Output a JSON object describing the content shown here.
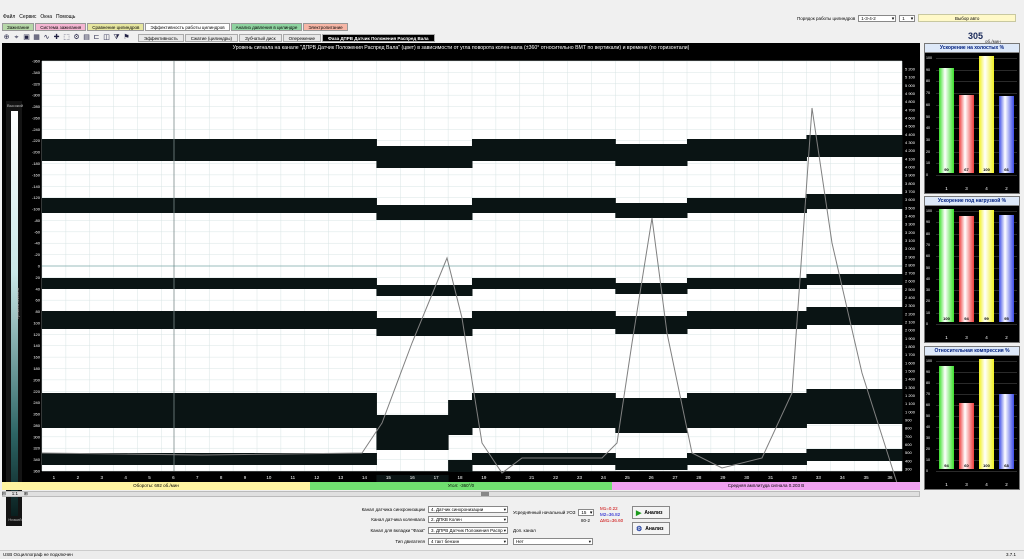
{
  "menu": [
    "Файл",
    "Сервис",
    "Окна",
    "Помощь"
  ],
  "top_tabs": [
    {
      "label": "Зажигание",
      "color": "#b6d7a8"
    },
    {
      "label": "Система зажигания",
      "color": "#f4b6d2"
    },
    {
      "label": "Сравнение цилиндров",
      "color": "#e6e6a0"
    },
    {
      "label": "Эффективность работы цилиндров",
      "color": "#ffffff"
    },
    {
      "label": "Анализ давления в цилиндре",
      "color": "#8fd3a0"
    },
    {
      "label": "Электропитание",
      "color": "#f6b6a6"
    }
  ],
  "top_right": {
    "order_label": "Порядок работы цилиндров",
    "order_value": "1-3-4-2",
    "cyl_value": "1",
    "car_select": "Выбор авто"
  },
  "toolbar_icons": [
    "zoom-icon",
    "cursor-icon",
    "photo-icon",
    "grid-icon",
    "channel-icon",
    "marker-icon",
    "zoom-area-icon",
    "settings-icon",
    "chart-icon",
    "ruler-icon",
    "cylinder-icon",
    "filter-icon",
    "flag-icon"
  ],
  "sub_tabs": [
    "Эффективность",
    "Сжатие (цилиндры)",
    "Зубчатый диск",
    "Опережение",
    "Фаза ДПРВ Датчик Положения Распред Вала"
  ],
  "active_sub_tab": 4,
  "rpm": {
    "value": "305",
    "unit": "об./мин"
  },
  "plot": {
    "title": "Уровень сигнала на канале \"ДПРВ Датчик Положения Распред Вала\" (цвет) в зависимости от угла поворота колен-вала (±360° относительно ВМТ по вертикали) и времени (по горизонтали)",
    "level_high": "Высокий",
    "level_low": "Низкий",
    "level_label": "Уровень сигнала",
    "left_ticks": [
      "-360",
      "-340",
      "-320",
      "-300",
      "-280",
      "-260",
      "-240",
      "-220",
      "-200",
      "-180",
      "-160",
      "-140",
      "-120",
      "-100",
      "-80",
      "-60",
      "-40",
      "-20",
      "0",
      "20",
      "40",
      "60",
      "80",
      "100",
      "120",
      "140",
      "160",
      "180",
      "200",
      "220",
      "240",
      "260",
      "280",
      "300",
      "320",
      "340",
      "360"
    ],
    "right_ticks": [
      "5 200",
      "5 100",
      "5 000",
      "4 900",
      "4 800",
      "4 700",
      "4 600",
      "4 500",
      "4 400",
      "4 300",
      "4 200",
      "4 100",
      "4 000",
      "3 900",
      "3 800",
      "3 700",
      "3 600",
      "3 500",
      "3 400",
      "3 300",
      "3 200",
      "3 100",
      "3 000",
      "2 900",
      "2 800",
      "2 700",
      "2 600",
      "2 500",
      "2 400",
      "2 300",
      "2 200",
      "2 100",
      "2 000",
      "1 900",
      "1 800",
      "1 700",
      "1 600",
      "1 500",
      "1 400",
      "1 300",
      "1 200",
      "1 100",
      "1 000",
      "900",
      "800",
      "700",
      "600",
      "500",
      "400",
      "300"
    ],
    "x_ticks": [
      "1",
      "2",
      "3",
      "4",
      "5",
      "6",
      "7",
      "8",
      "9",
      "10",
      "11",
      "12",
      "13",
      "14",
      "15",
      "16",
      "17",
      "18",
      "19",
      "20",
      "21",
      "22",
      "23",
      "24",
      "25",
      "26",
      "27",
      "28",
      "29",
      "30",
      "31",
      "32",
      "33",
      "34",
      "35",
      "36"
    ]
  },
  "bottom_strip": {
    "rpm_text": "Обороты: 692 об./мин",
    "shaft_text": "Угол: -360°/0",
    "amp_text": "Средняя амплитуда сигнала 0.203 В"
  },
  "zoom": {
    "ratio": "1:1"
  },
  "controls": {
    "sync_label": "Канал датчика синхронизации",
    "sync_value": "4. Датчик синхронизации",
    "crank_label": "Канал датчика коленвала",
    "crank_value": "2. ДПКВ Колен",
    "phase_label": "Канал для вкладки \"Фаза\"",
    "phase_value": "3. ДПРВ Датчик Положения Распр",
    "engine_label": "Тип двигателя",
    "engine_value": "4 такт бензин",
    "uoz_label": "Усреднённый начальный УОЗ",
    "uoz_value": "15",
    "uoz_extra": "80-2",
    "m1": "M1=0.22",
    "m2": "M2=36.82",
    "dm": "ΔM1=36.60",
    "extra_label": "Доп. канал",
    "extra_value": "Нет",
    "analyze1": "Анализ",
    "analyze2": "Анализ"
  },
  "status": {
    "text": "USB Осциллограф не подключен",
    "version": "3.7.1"
  },
  "panels": [
    {
      "title": "Ускорение на холостых %",
      "bars": [
        {
          "cyl": "1",
          "value": 90,
          "color": "#3ae02a"
        },
        {
          "cyl": "3",
          "value": 67,
          "color": "#ee3a3a"
        },
        {
          "cyl": "4",
          "value": 100,
          "color": "#f0f020"
        },
        {
          "cyl": "2",
          "value": 66,
          "color": "#3a4ae6"
        }
      ]
    },
    {
      "title": "Ускорение под нагрузкой %",
      "bars": [
        {
          "cyl": "1",
          "value": 100,
          "color": "#3ae02a"
        },
        {
          "cyl": "3",
          "value": 94,
          "color": "#ee3a3a"
        },
        {
          "cyl": "4",
          "value": 99,
          "color": "#f0f020"
        },
        {
          "cyl": "2",
          "value": 95,
          "color": "#3a4ae6"
        }
      ]
    },
    {
      "title": "Относительная компрессия %",
      "bars": [
        {
          "cyl": "1",
          "value": 94,
          "color": "#3ae02a"
        },
        {
          "cyl": "3",
          "value": 60,
          "color": "#ee3a3a"
        },
        {
          "cyl": "4",
          "value": 100,
          "color": "#f0f020"
        },
        {
          "cyl": "2",
          "value": 68,
          "color": "#3a4ae6"
        }
      ]
    }
  ],
  "panel_axis": [
    "100",
    "90",
    "80",
    "70",
    "60",
    "50",
    "40",
    "30",
    "20",
    "10",
    "0"
  ]
}
